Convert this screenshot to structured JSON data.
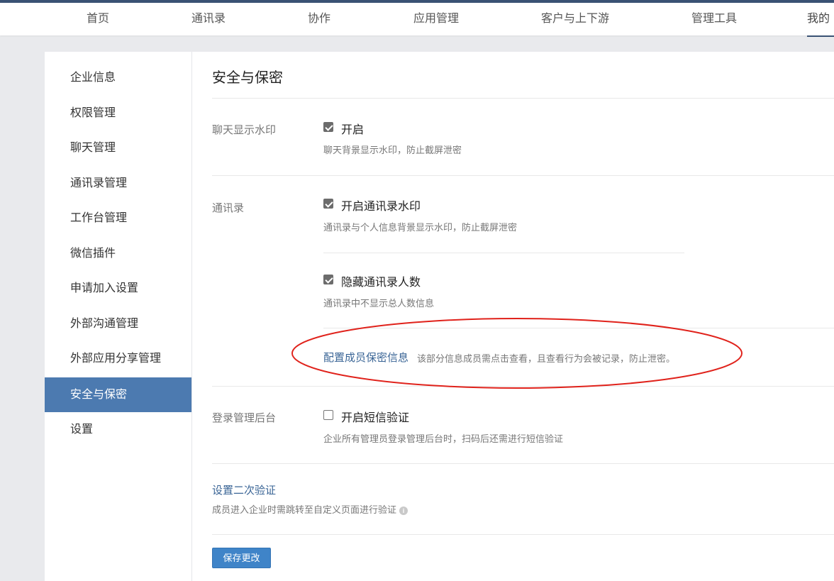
{
  "topnav": {
    "items": [
      {
        "label": "首页"
      },
      {
        "label": "通讯录"
      },
      {
        "label": "协作"
      },
      {
        "label": "应用管理"
      },
      {
        "label": "客户与上下游"
      },
      {
        "label": "管理工具"
      },
      {
        "label": "我的"
      }
    ],
    "active_index": 6
  },
  "sidebar": {
    "items": [
      {
        "label": "企业信息"
      },
      {
        "label": "权限管理"
      },
      {
        "label": "聊天管理"
      },
      {
        "label": "通讯录管理"
      },
      {
        "label": "工作台管理"
      },
      {
        "label": "微信插件"
      },
      {
        "label": "申请加入设置"
      },
      {
        "label": "外部沟通管理"
      },
      {
        "label": "外部应用分享管理"
      },
      {
        "label": "安全与保密"
      },
      {
        "label": "设置"
      }
    ],
    "active_index": 9
  },
  "main": {
    "title": "安全与保密",
    "chat_watermark": {
      "label": "聊天显示水印",
      "option_label": "开启",
      "checked": true,
      "description": "聊天背景显示水印，防止截屏泄密"
    },
    "contacts": {
      "label": "通讯录",
      "watermark_option": {
        "label": "开启通讯录水印",
        "checked": true,
        "description": "通讯录与个人信息背景显示水印，防止截屏泄密"
      },
      "hide_count_option": {
        "label": "隐藏通讯录人数",
        "checked": true,
        "description": "通讯录中不显示总人数信息"
      },
      "confidential_link": "配置成员保密信息",
      "confidential_desc": "该部分信息成员需点击查看，且查看行为会被记录，防止泄密。"
    },
    "admin_login": {
      "label": "登录管理后台",
      "option_label": "开启短信验证",
      "checked": false,
      "description": "企业所有管理员登录管理后台时，扫码后还需进行短信验证"
    },
    "second_verify": {
      "link": "设置二次验证",
      "description": "成员进入企业时需跳转至自定义页面进行验证"
    },
    "save_button": "保存更改"
  },
  "colors": {
    "active_sidebar_bg": "#4c7ab0",
    "link": "#3a6596",
    "primary_button": "#3f84c8",
    "annotation_ellipse": "#e0221b"
  },
  "icons": {
    "checkbox_checked": "checkbox-checked-icon",
    "checkbox_unchecked": "checkbox-unchecked-icon",
    "info": "info-icon"
  }
}
